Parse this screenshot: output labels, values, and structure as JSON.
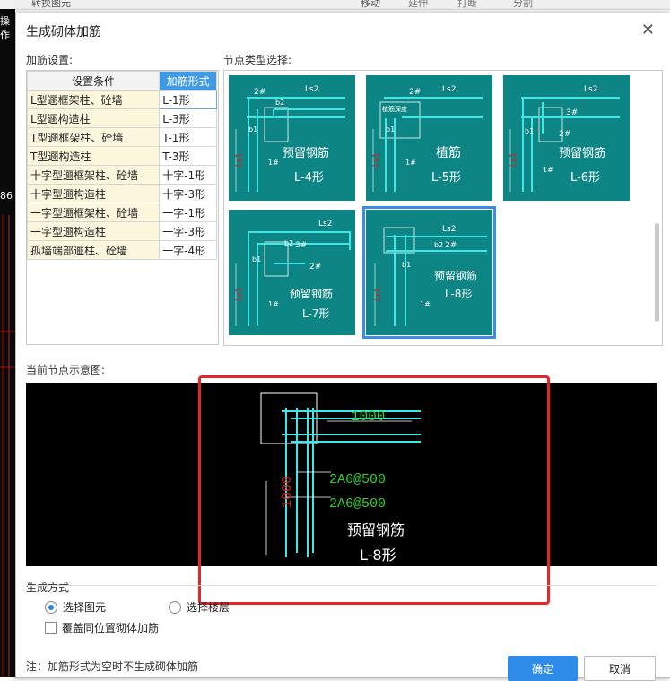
{
  "background": {
    "toolbar": [
      "转换图元",
      "移动",
      "延伸",
      "打断",
      "分割"
    ],
    "left_texts": [
      "操作",
      "86"
    ]
  },
  "dialog": {
    "title": "生成砌体加筋",
    "settings_label": "加筋设置:",
    "node_type_label": "节点类型选择:",
    "current_node_label": "当前节点示意图:",
    "generation_label": "生成方式",
    "table": {
      "headers": [
        "设置条件",
        "加筋形式"
      ],
      "rows": [
        {
          "cond": "L型逦框架柱、砼墙",
          "form": "L-1形"
        },
        {
          "cond": "L型逦构造柱",
          "form": "L-3形"
        },
        {
          "cond": "T型逦框架柱、砼墙",
          "form": "T-1形"
        },
        {
          "cond": "T型逦构造柱",
          "form": "T-3形"
        },
        {
          "cond": "十字型逦框架柱、砼墙",
          "form": "十字-1形"
        },
        {
          "cond": "十字型逦构造柱",
          "form": "十字-3形"
        },
        {
          "cond": "一字型逦框架柱、砼墙",
          "form": "一字-1形"
        },
        {
          "cond": "一字型逦构造柱",
          "form": "一字-3形"
        },
        {
          "cond": "孤墙端部逦柱、砼墙",
          "form": "一字-4形"
        }
      ]
    },
    "nodes": [
      {
        "name": "预留钢筋",
        "form": "L-4形",
        "labels": [
          "2#",
          "Ls2",
          "b2",
          "b1",
          "1#",
          "Ls1"
        ]
      },
      {
        "name": "植筋",
        "form": "L-5形",
        "labels": [
          "2#",
          "Ls2",
          "植筋深度",
          "b1",
          "1#",
          "Ls1"
        ]
      },
      {
        "name": "预留钢筋",
        "form": "L-6形",
        "labels": [
          "Ls2",
          "3#",
          "2#",
          "b1",
          "1#",
          "Ls1"
        ]
      },
      {
        "name": "预留钢筋",
        "form": "L-7形",
        "labels": [
          "Ls2",
          "b2",
          "3#",
          "b1",
          "2#",
          "1#",
          "Ls1"
        ]
      },
      {
        "name": "预留钢筋",
        "form": "L-8形",
        "labels": [
          "Ls2",
          "b2",
          "2#",
          "b1",
          "1#",
          "Ls1"
        ]
      }
    ],
    "preview": {
      "dim_top": "1000",
      "dim_left": "1000",
      "rebar1": "2A6@500",
      "rebar2": "2A6@500",
      "name": "预留钢筋",
      "form": "L-8形"
    },
    "radio_select_element": "选择图元",
    "radio_select_floor": "选择楼层",
    "checkbox_overwrite": "覆盖同位置砌体加筋",
    "note": "注：加筋形式为空时不生成砌体加筋",
    "ok_button": "确定",
    "cancel_button": "取消",
    "colors": {
      "teal": "#0e8585",
      "cyan": "#3fe6e6",
      "green": "#2fd12f",
      "red": "#e01d1d",
      "accent": "#2f8be8"
    }
  }
}
